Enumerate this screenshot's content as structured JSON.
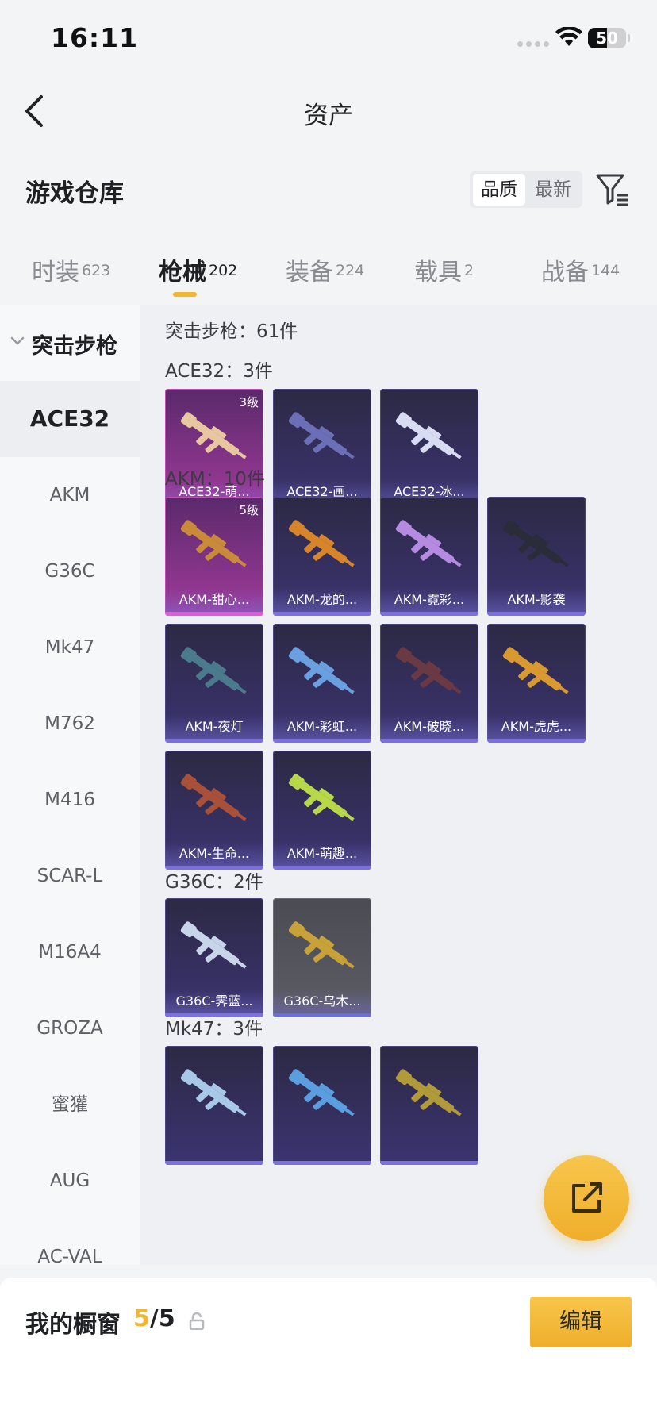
{
  "status_bar": {
    "time": "16:11",
    "battery": "50",
    "battery_level": 0.5
  },
  "nav": {
    "title": "资产"
  },
  "warehouse": {
    "title": "游戏仓库",
    "sort_options": [
      {
        "label": "品质",
        "active": true
      },
      {
        "label": "最新",
        "active": false
      }
    ]
  },
  "tabs": [
    {
      "label": "时装",
      "count": "623",
      "active": false
    },
    {
      "label": "枪械",
      "count": "202",
      "active": true
    },
    {
      "label": "装备",
      "count": "224",
      "active": false
    },
    {
      "label": "载具",
      "count": "2",
      "active": false
    },
    {
      "label": "战备",
      "count": "144",
      "active": false
    }
  ],
  "sidebar": {
    "category": "突击步枪",
    "items": [
      {
        "label": "ACE32",
        "active": true
      },
      {
        "label": "AKM",
        "active": false
      },
      {
        "label": "G36C",
        "active": false
      },
      {
        "label": "Mk47",
        "active": false
      },
      {
        "label": "M762",
        "active": false
      },
      {
        "label": "M416",
        "active": false
      },
      {
        "label": "SCAR-L",
        "active": false
      },
      {
        "label": "M16A4",
        "active": false
      },
      {
        "label": "GROZA",
        "active": false
      },
      {
        "label": "蜜獾",
        "active": false
      },
      {
        "label": "AUG",
        "active": false
      },
      {
        "label": "AC-VAL",
        "active": false
      }
    ]
  },
  "content": {
    "total": "突击步枪：61件",
    "groups": [
      {
        "label": "ACE32：3件",
        "cards": [
          {
            "name": "ACE32-萌...",
            "level": "3级",
            "rarity": "pink",
            "color": "#e8c7a0"
          },
          {
            "name": "ACE32-画...",
            "level": "",
            "rarity": "purple",
            "color": "#6a6fb8"
          },
          {
            "name": "ACE32-冰...",
            "level": "",
            "rarity": "purple",
            "color": "#d8dcf2"
          }
        ]
      },
      {
        "label": "AKM：10件",
        "cards": [
          {
            "name": "AKM-甜心...",
            "level": "5级",
            "rarity": "pink",
            "color": "#c98a3a"
          },
          {
            "name": "AKM-龙的...",
            "level": "",
            "rarity": "purple",
            "color": "#d8842a"
          },
          {
            "name": "AKM-霓彩...",
            "level": "",
            "rarity": "purple",
            "color": "#b68ae0"
          },
          {
            "name": "AKM-影袭",
            "level": "",
            "rarity": "purple",
            "color": "#2a2c3a"
          },
          {
            "name": "AKM-夜灯",
            "level": "",
            "rarity": "purple",
            "color": "#4a7a8c"
          },
          {
            "name": "AKM-彩虹...",
            "level": "",
            "rarity": "purple",
            "color": "#6aa0e0"
          },
          {
            "name": "AKM-破晓...",
            "level": "",
            "rarity": "purple",
            "color": "#6a3a44"
          },
          {
            "name": "AKM-虎虎...",
            "level": "",
            "rarity": "purple",
            "color": "#d89a30"
          },
          {
            "name": "AKM-生命...",
            "level": "",
            "rarity": "purple",
            "color": "#a8503a"
          },
          {
            "name": "AKM-萌趣...",
            "level": "",
            "rarity": "purple",
            "color": "#b8d84a"
          }
        ]
      },
      {
        "label": "G36C：2件",
        "cards": [
          {
            "name": "G36C-霁蓝...",
            "level": "",
            "rarity": "purple",
            "color": "#c8d4e8"
          },
          {
            "name": "G36C-乌木...",
            "level": "",
            "rarity": "gray",
            "color": "#c8a238"
          }
        ]
      },
      {
        "label": "Mk47：3件",
        "cards": [
          {
            "name": "",
            "level": "",
            "rarity": "purple",
            "color": "#a8c8e8"
          },
          {
            "name": "",
            "level": "",
            "rarity": "purple",
            "color": "#5a9ee0"
          },
          {
            "name": "",
            "level": "",
            "rarity": "purple",
            "color": "#b09a3a"
          }
        ]
      }
    ]
  },
  "bottom": {
    "showcase_label": "我的橱窗",
    "showcase_current": "5",
    "showcase_total": "/5",
    "edit_label": "编辑"
  },
  "icons": {
    "back": "back-icon",
    "filter": "filter-icon",
    "share": "share-icon",
    "lock": "lock-icon",
    "wifi": "wifi-icon"
  },
  "colors": {
    "accent": "#f2b632",
    "card_purple": "#3b3472",
    "card_pink": "#a03a9a"
  }
}
